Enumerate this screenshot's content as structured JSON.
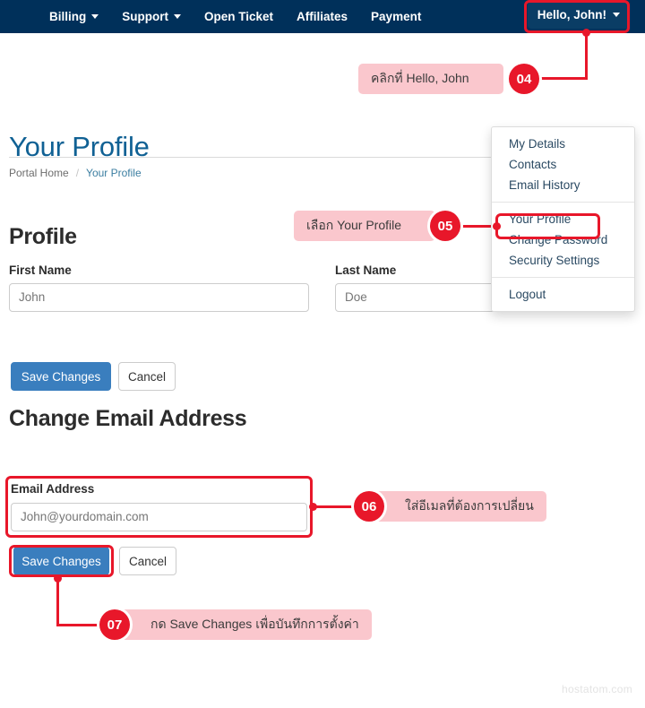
{
  "navbar": {
    "background": "#00305a",
    "items": [
      {
        "label": "Billing",
        "has_caret": true
      },
      {
        "label": "Support",
        "has_caret": true
      },
      {
        "label": "Open Ticket",
        "has_caret": false
      },
      {
        "label": "Affiliates",
        "has_caret": false
      },
      {
        "label": "Payment",
        "has_caret": false
      }
    ],
    "user_label": "Hello, John!"
  },
  "dropdown": {
    "group1": [
      "My Details",
      "Contacts",
      "Email History"
    ],
    "group2": [
      "Your Profile",
      "Change Password",
      "Security Settings"
    ],
    "group3": [
      "Logout"
    ]
  },
  "page": {
    "title": "Your Profile",
    "breadcrumb": {
      "home": "Portal Home",
      "separator": "/",
      "current": "Your Profile"
    }
  },
  "profile": {
    "heading": "Profile",
    "first_name_label": "First Name",
    "first_name_value": "John",
    "last_name_label": "Last Name",
    "last_name_value": "Doe",
    "save_label": "Save Changes",
    "cancel_label": "Cancel"
  },
  "email_section": {
    "heading": "Change Email Address",
    "email_label": "Email Address",
    "email_value": "John@yourdomain.com",
    "save_label": "Save Changes",
    "cancel_label": "Cancel"
  },
  "callouts": [
    {
      "number": "04",
      "text": "คลิกที่ Hello, John"
    },
    {
      "number": "05",
      "text": "เลือก Your Profile"
    },
    {
      "number": "06",
      "text": "ใส่อีเมลที่ต้องการเปลี่ยน"
    },
    {
      "number": "07",
      "text": "กด Save Changes เพื่อบันทึกการตั้งค่า"
    }
  ],
  "watermark": "hostatom.com",
  "colors": {
    "nav_bg": "#00305a",
    "accent_red": "#e8172a",
    "callout_bg": "#fac7cd",
    "primary_button": "#3a7ebe",
    "title_blue": "#106194"
  }
}
